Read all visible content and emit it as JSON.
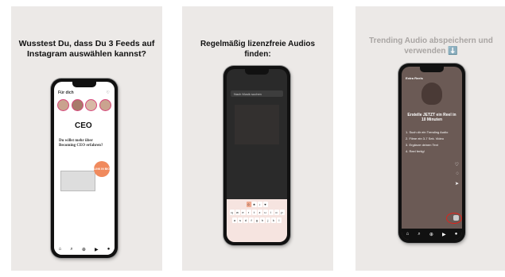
{
  "panels": [
    {
      "title": "Wusstest Du, dass Du 3 Feeds auf Instagram auswählen kannst?",
      "screen": {
        "feed_label": "Für dich",
        "brand": "CEO",
        "headline": "Du willst mehr über Becoming CEO erfahren?",
        "button": "LINK IN BIO"
      }
    },
    {
      "title": "Regelmäßig lizenzfreie Audios finden:",
      "screen": {
        "search_placeholder": "Nach Musik suchen",
        "keys_row1": [
          "q",
          "w",
          "e",
          "r",
          "t",
          "z",
          "u",
          "i",
          "o",
          "p"
        ],
        "keys_row2": [
          "a",
          "s",
          "d",
          "f",
          "g",
          "h",
          "j",
          "k",
          "l"
        ]
      }
    },
    {
      "title": "Trending Audio abspeichern und verwenden ⬇️",
      "screen": {
        "account": "Extra Reels",
        "headline": "Erstelle JETZT ein Reel in 10 Minuten",
        "steps": [
          "1. Such dir ein Trending Audio",
          "2. Filme ein 3-7 Sek. Video",
          "3. Ergänze deinen Text",
          "4. Reel fertig!"
        ]
      }
    }
  ],
  "colors": {
    "accent_pink": "#d6457a",
    "highlight_red": "#e2231a",
    "cta_orange": "#f08a5d"
  }
}
